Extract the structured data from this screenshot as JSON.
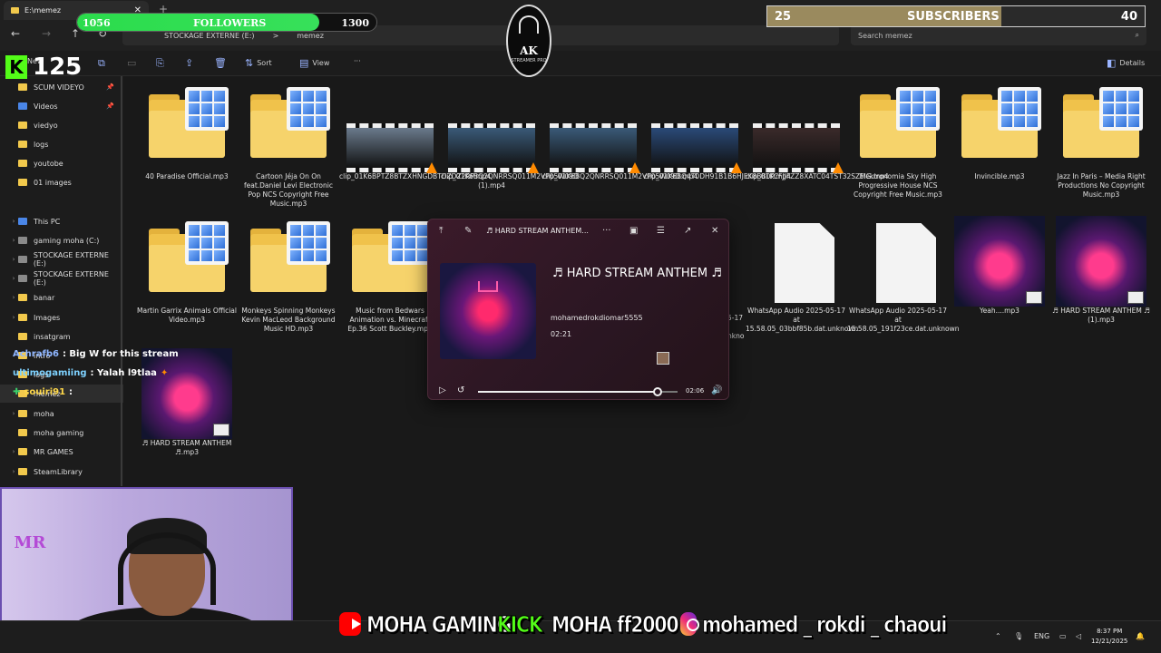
{
  "window": {
    "tab_title": "E:\\memez",
    "new_tab": "+",
    "close": "✕"
  },
  "nav": {
    "back": "←",
    "forward": "→",
    "up": "↑",
    "refresh": "↻"
  },
  "address": {
    "root": "STOCKAGE EXTERNE (E:)",
    "sep": ">",
    "folder": "memez"
  },
  "search": {
    "placeholder": "Search memez",
    "icon": "⌕"
  },
  "commands": {
    "new": "New",
    "sort": "Sort",
    "view": "View",
    "more": "···",
    "details": "Details"
  },
  "sidebar": {
    "items": [
      {
        "label": "SCUM VIDEYO",
        "pinned": true
      },
      {
        "label": "Videos",
        "pinned": true
      },
      {
        "label": "viedyo"
      },
      {
        "label": "logs"
      },
      {
        "label": "youtobe"
      },
      {
        "label": "01 images"
      },
      {
        "label": "This PC"
      },
      {
        "label": "gaming moha (C:)"
      },
      {
        "label": "STOCKAGE EXTERNE (E:)"
      },
      {
        "label": "STOCKAGE EXTERNE (E:)"
      },
      {
        "label": "banar"
      },
      {
        "label": "Images"
      },
      {
        "label": "insatgram"
      },
      {
        "label": "intro"
      },
      {
        "label": "logs"
      },
      {
        "label": "memez"
      },
      {
        "label": "moha"
      },
      {
        "label": "moha gaming"
      },
      {
        "label": "MR GAMES"
      },
      {
        "label": "SteamLibrary"
      }
    ]
  },
  "files": [
    {
      "name": "40 Paradise Official.mp3",
      "kind": "folder-app"
    },
    {
      "name": "Cartoon Jéja On On feat.Daniel Levi Electronic Pop NCS Copyright Free Music.mp3",
      "kind": "folder-app"
    },
    {
      "name": "clip_01K6BPTZ8BTZXHNGDBTDZDZ2RP.mp4",
      "kind": "video"
    },
    {
      "name": "clip_01K6BQ2QNRRSQ011M2VP05W09D (1).mp4",
      "kind": "video"
    },
    {
      "name": "clip_01K6BQ2QNRRSQ011M2VP05W09D.mp4",
      "kind": "video"
    },
    {
      "name": "clip_01K6BQ4T0DH91B1B6HJEK8BB0P.mp4",
      "kind": "video"
    },
    {
      "name": "clip_01KCFJJFZZ8XATC04TST32SZMG.mp4",
      "kind": "video"
    },
    {
      "name": "Elektronomia Sky High Progressive House NCS Copyright Free Music.mp3",
      "kind": "folder-app"
    },
    {
      "name": "Invincible.mp3",
      "kind": "folder-app"
    },
    {
      "name": "Jazz In Paris – Media Right Productions No Copyright Music.mp3",
      "kind": "folder-app"
    },
    {
      "name": "Martin Garrix Animals Official Video.mp3",
      "kind": "folder-app"
    },
    {
      "name": "Monkeys Spinning Monkeys Kevin MacLeod Background Music HD.mp3",
      "kind": "folder-app"
    },
    {
      "name": "Music from Bedwars Animation vs. Minecraft Ep.36 Scott Buckley.mp3",
      "kind": "folder-app"
    },
    {
      "name": "WhatsApp Audio 2025-05-17 at 15.58.05_03bbf85b.dat.unknown",
      "kind": "doc"
    },
    {
      "name": "WhatsApp Audio 2025-05-17 at 15.58.05_191f23ce.dat.unknown",
      "kind": "doc"
    },
    {
      "name": "Yeah....mp3",
      "kind": "art"
    },
    {
      "name": "♬ HARD STREAM ANTHEM ♬ (1).mp3",
      "kind": "art"
    },
    {
      "name": "♬ HARD STREAM ANTHEM ♬.mp3",
      "kind": "art"
    }
  ],
  "hidden_names": {
    "a": "5-17",
    "b": "nkno"
  },
  "player": {
    "window_title": "♬ HARD STREAM ANTHEM...",
    "track_title": "♬ HARD STREAM ANTHEM ♬",
    "artist": "mohamedrokdiomar5555",
    "duration": "02:21",
    "elapsed": "02:06",
    "progress": 0.9,
    "icons": {
      "note": "♫",
      "pin": "✎",
      "more": "···",
      "close": "✕"
    }
  },
  "overlay": {
    "followers": {
      "current": "1056",
      "label": "FOLLOWERS",
      "goal": "1300",
      "progress": 0.81
    },
    "subscribers": {
      "current": "25",
      "label": "SUBSCRIBERS",
      "goal": "40",
      "progress": 0.62
    },
    "logo": {
      "name": "AK",
      "sub": "STREAMER PRO"
    },
    "kick": {
      "letter": "K",
      "count": "125"
    },
    "chat": [
      {
        "user": "Achrafb6",
        "text": ": Big W for this stream"
      },
      {
        "user": "ultimogamiing",
        "text": ": Yalah l9tlaa"
      },
      {
        "user": "souiri91",
        "text": ":"
      }
    ],
    "webcam_logo": "MR",
    "banner": {
      "youtube": "MOHA GAMING",
      "kick_label": "KICK",
      "kick": "MOHA ff2000",
      "instagram": "mohamed _ rokdi _ chaoui"
    }
  },
  "taskbar": {
    "lang": "ENG",
    "time": "8:37 PM",
    "date": "12/21/2025"
  },
  "colors": {
    "accent_green": "#53fc18",
    "youtube_red": "#ff0000",
    "player_bg": "#2a1622"
  }
}
